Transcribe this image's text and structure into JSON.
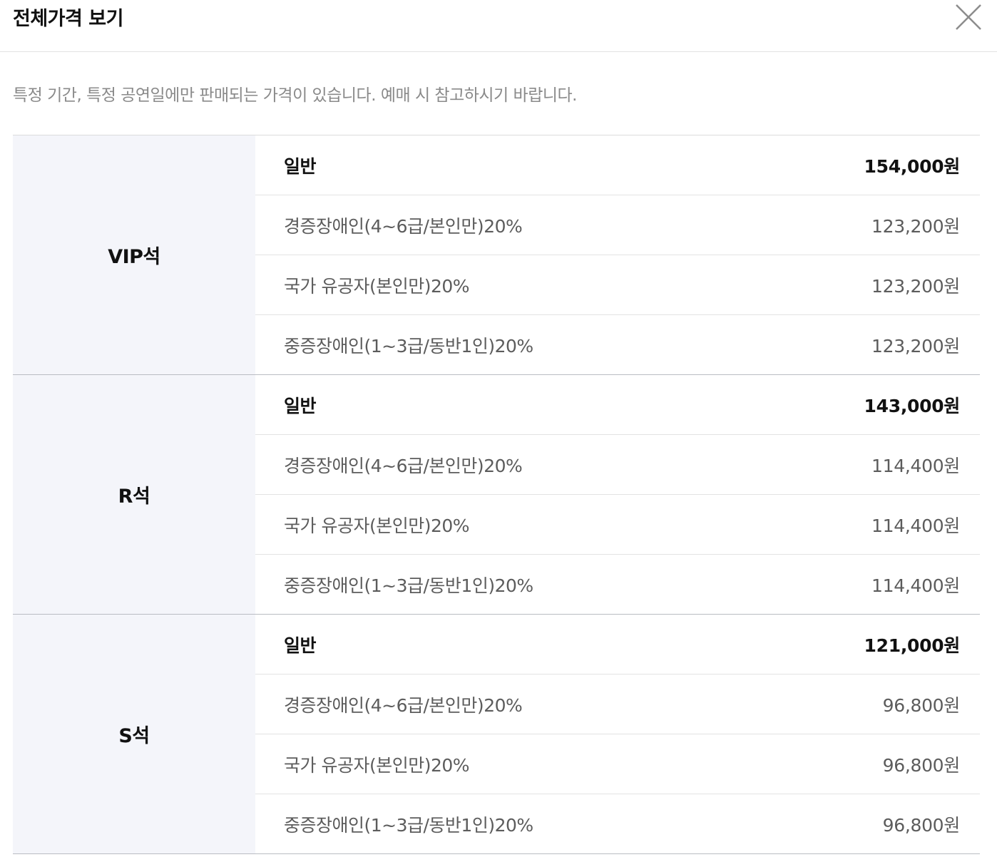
{
  "header": {
    "title": "전체가격 보기",
    "close_icon": "close-icon"
  },
  "notice": "특정 기간, 특정 공연일에만 판매되는 가격이 있습니다. 예매 시 참고하시기 바랍니다.",
  "seats": [
    {
      "name": "VIP석",
      "rows": [
        {
          "label": "일반",
          "price": "154,000원"
        },
        {
          "label": "경증장애인(4~6급/본인만)20%",
          "price": "123,200원"
        },
        {
          "label": "국가 유공자(본인만)20%",
          "price": "123,200원"
        },
        {
          "label": "중증장애인(1~3급/동반1인)20%",
          "price": "123,200원"
        }
      ]
    },
    {
      "name": "R석",
      "rows": [
        {
          "label": "일반",
          "price": "143,000원"
        },
        {
          "label": "경증장애인(4~6급/본인만)20%",
          "price": "114,400원"
        },
        {
          "label": "국가 유공자(본인만)20%",
          "price": "114,400원"
        },
        {
          "label": "중증장애인(1~3급/동반1인)20%",
          "price": "114,400원"
        }
      ]
    },
    {
      "name": "S석",
      "rows": [
        {
          "label": "일반",
          "price": "121,000원"
        },
        {
          "label": "경증장애인(4~6급/본인만)20%",
          "price": "96,800원"
        },
        {
          "label": "국가 유공자(본인만)20%",
          "price": "96,800원"
        },
        {
          "label": "중증장애인(1~3급/동반1인)20%",
          "price": "96,800원"
        }
      ]
    }
  ]
}
